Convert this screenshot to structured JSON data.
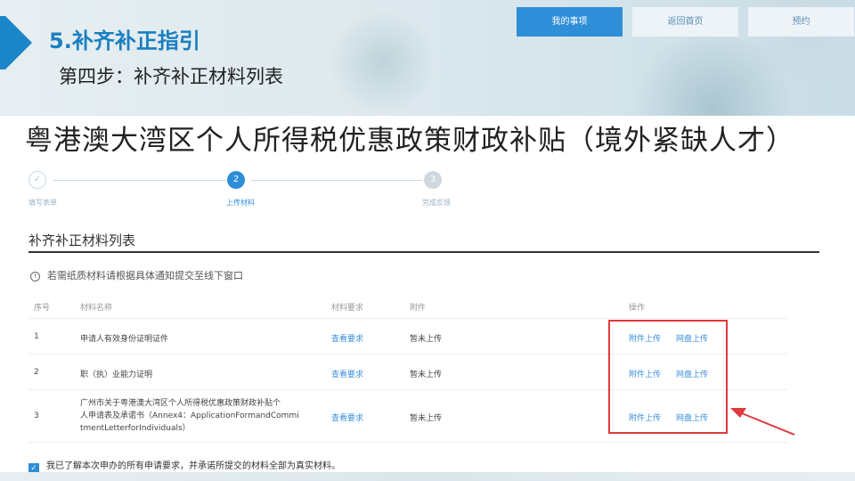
{
  "banner": {
    "step_title": "5.补齐补正指引",
    "step_subtitle": "第四步：补齐补正材料列表"
  },
  "top_nav": {
    "items": [
      {
        "label": "我的事项",
        "active": true
      },
      {
        "label": "返回首页",
        "active": false
      },
      {
        "label": "预约",
        "active": false
      }
    ]
  },
  "main_title": "粤港澳大湾区个人所得税优惠政策财政补贴（境外紧缺人才）",
  "steps": [
    {
      "number": "✓",
      "label": "填写表单",
      "state": "done"
    },
    {
      "number": "2",
      "label": "上传材料",
      "state": "current"
    },
    {
      "number": "3",
      "label": "完成反馈",
      "state": "todo"
    }
  ],
  "section_title": "补齐补正材料列表",
  "notice": {
    "icon": "info-icon",
    "icon_glyph": "!",
    "text": "若需纸质材料请根据具体通知提交至线下窗口"
  },
  "table": {
    "headers": [
      "序号",
      "材料名称",
      "材料要求",
      "附件",
      "操作"
    ],
    "rows": [
      {
        "index": "1",
        "name": "申请人有效身份证明证件",
        "requirement": "查看要求",
        "attachment": "暂未上传",
        "action_upload": "附件上传",
        "action_cloud": "网盘上传"
      },
      {
        "index": "2",
        "name": "职（执）业能力证明",
        "requirement": "查看要求",
        "attachment": "暂未上传",
        "action_upload": "附件上传",
        "action_cloud": "网盘上传"
      },
      {
        "index": "3",
        "name_line1": "广州市关于粤港澳大湾区个人所得税优惠政策财政补贴个",
        "name_line2": "人申请表及承诺书（Annex4：ApplicationFormandCommi",
        "name_line3": "tmentLetterforIndividuals）",
        "requirement": "查看要求",
        "attachment": "暂未上传",
        "action_upload": "附件上传",
        "action_cloud": "网盘上传"
      }
    ]
  },
  "agreement": {
    "checked": true,
    "check_glyph": "✓",
    "text": "我已了解本次申办的所有申请要求，并承诺所提交的材料全部为真实材料。"
  },
  "colors": {
    "accent": "#2e8fd8",
    "title_blue": "#1a7fc1",
    "link": "#3a8fdc",
    "highlight": "#e0393e"
  }
}
